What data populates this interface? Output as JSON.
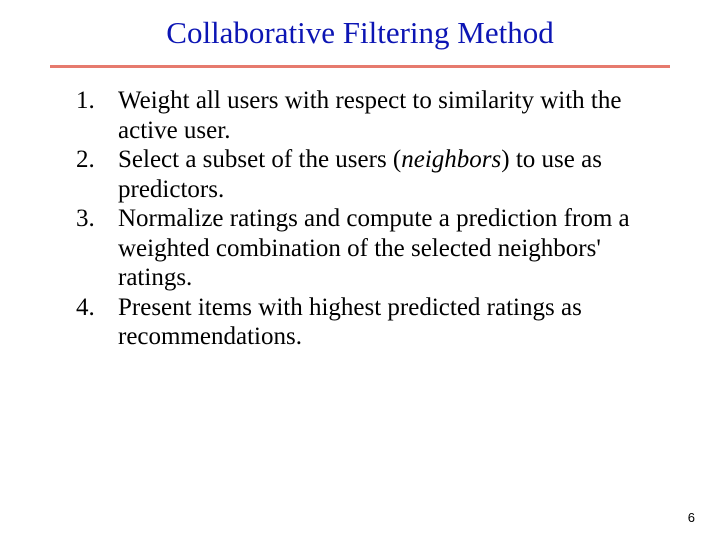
{
  "title": "Collaborative Filtering Method",
  "steps": [
    {
      "prefix": "Weight all users with respect to similarity with the active user.",
      "italic": "",
      "suffix": ""
    },
    {
      "prefix": "Select a subset of the users (",
      "italic": "neighbors",
      "suffix": ") to use as predictors."
    },
    {
      "prefix": "Normalize ratings and compute a prediction from a weighted combination of the selected neighbors' ratings.",
      "italic": "",
      "suffix": ""
    },
    {
      "prefix": "Present items with highest predicted ratings as recommendations.",
      "italic": "",
      "suffix": ""
    }
  ],
  "page_number": "6"
}
